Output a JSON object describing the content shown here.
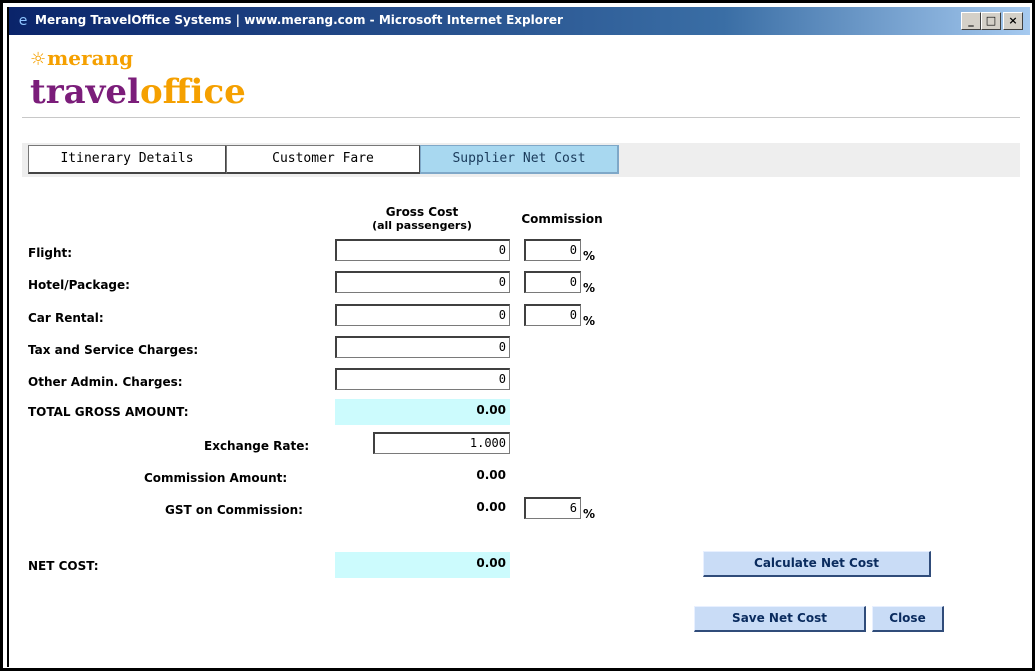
{
  "window": {
    "title": "Merang TravelOffice Systems | www.merang.com - Microsoft Internet Explorer",
    "minimize": "_",
    "maximize": "□",
    "close": "×"
  },
  "logo": {
    "top": "merang",
    "main_a": "travel",
    "main_b": "office"
  },
  "tabs": [
    {
      "label": "Itinerary Details",
      "active": false
    },
    {
      "label": "Customer Fare",
      "active": false
    },
    {
      "label": "Supplier Net Cost",
      "active": true
    }
  ],
  "headers": {
    "gross": "Gross Cost",
    "gross_sub": "(all passengers)",
    "commission": "Commission"
  },
  "rows": [
    {
      "label": "Flight:",
      "gross": "0",
      "commission": "0",
      "pct": "%"
    },
    {
      "label": "Hotel/Package:",
      "gross": "0",
      "commission": "0",
      "pct": "%"
    },
    {
      "label": "Car Rental:",
      "gross": "0",
      "commission": "0",
      "pct": "%"
    },
    {
      "label": "Tax and Service Charges:",
      "gross": "0"
    },
    {
      "label": "Other Admin. Charges:",
      "gross": "0"
    }
  ],
  "total_gross": {
    "label": "TOTAL GROSS AMOUNT:",
    "value": "0.00"
  },
  "exchange_rate": {
    "label": "Exchange Rate:",
    "value": "1.000"
  },
  "commission_amount": {
    "label": "Commission Amount:",
    "value": "0.00"
  },
  "gst": {
    "label": "GST on Commission:",
    "value": "0.00",
    "rate": "6",
    "pct": "%"
  },
  "net_cost": {
    "label": "NET COST:",
    "value": "0.00"
  },
  "buttons": {
    "calculate": "Calculate Net Cost",
    "save": "Save Net Cost",
    "close": "Close"
  }
}
